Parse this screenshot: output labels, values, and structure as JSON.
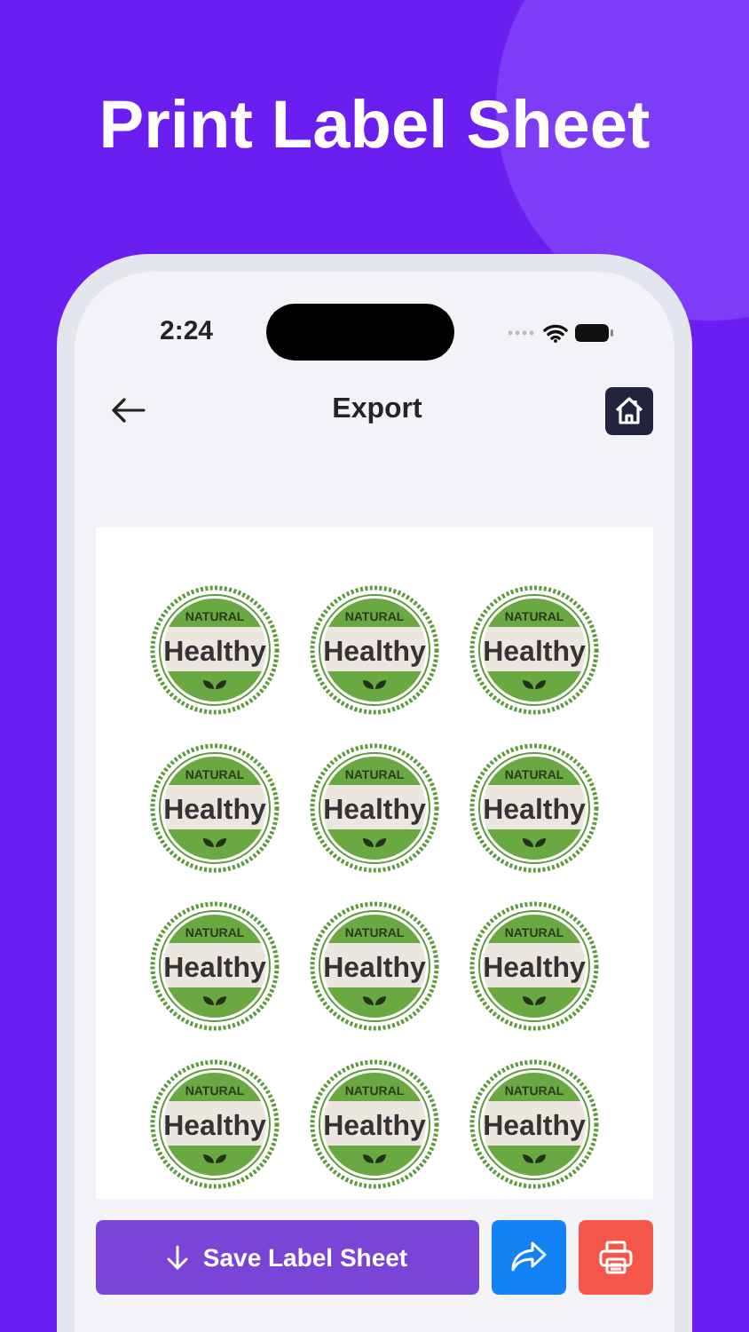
{
  "headline": "Print Label Sheet",
  "status_bar": {
    "time": "2:24"
  },
  "nav": {
    "title": "Export"
  },
  "labels": [
    {
      "top": "NATURAL",
      "main": "Healthy"
    },
    {
      "top": "NATURAL",
      "main": "Healthy"
    },
    {
      "top": "NATURAL",
      "main": "Healthy"
    },
    {
      "top": "NATURAL",
      "main": "Healthy"
    },
    {
      "top": "NATURAL",
      "main": "Healthy"
    },
    {
      "top": "NATURAL",
      "main": "Healthy"
    },
    {
      "top": "NATURAL",
      "main": "Healthy"
    },
    {
      "top": "NATURAL",
      "main": "Healthy"
    },
    {
      "top": "NATURAL",
      "main": "Healthy"
    },
    {
      "top": "NATURAL",
      "main": "Healthy"
    },
    {
      "top": "NATURAL",
      "main": "Healthy"
    },
    {
      "top": "NATURAL",
      "main": "Healthy"
    }
  ],
  "actions": [
    {
      "kind": "save",
      "label": "Save Label Sheet"
    },
    {
      "kind": "share"
    },
    {
      "kind": "print"
    }
  ]
}
